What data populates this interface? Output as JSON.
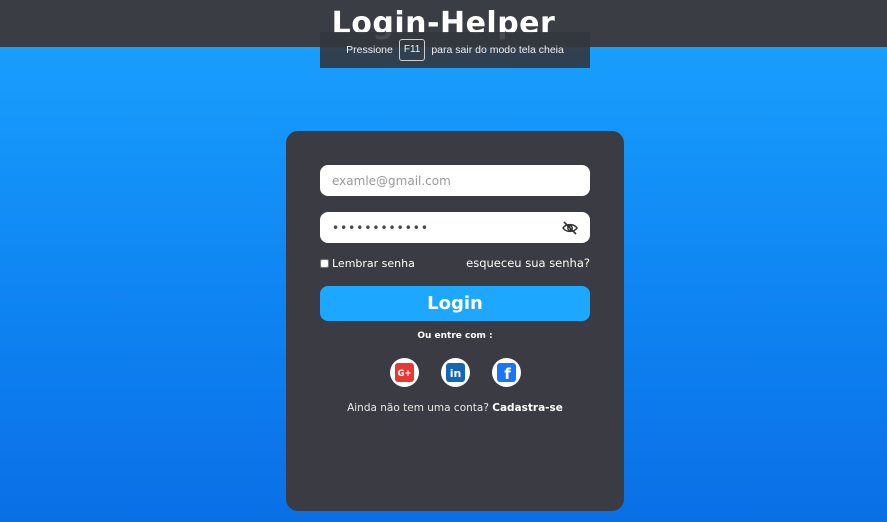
{
  "app": {
    "title": "Login-Helper"
  },
  "fullscreen_hint": {
    "before": "Pressione",
    "key": "F11",
    "after": "para sair do modo tela cheia"
  },
  "form": {
    "email_placeholder": "examle@gmail.com",
    "password_value": "••••••••••••",
    "remember_label": "Lembrar senha",
    "forgot_label": "esqueceu sua senha?",
    "login_label": "Login",
    "or_label": "Ou entre com :",
    "signup_prompt": "Ainda não tem uma conta?",
    "signup_link": "Cadastra-se"
  },
  "socials": [
    {
      "name": "google-plus-icon",
      "text": "G+",
      "color": "#e53935"
    },
    {
      "name": "linkedin-icon",
      "text": "in",
      "color": "#1467b5"
    },
    {
      "name": "facebook-icon",
      "text": "f",
      "color": "#1877f2"
    }
  ],
  "colors": {
    "background": "#1a9af8",
    "card": "#3a3b43",
    "accent": "#1da7ff",
    "topbar": "#3b3d44"
  }
}
